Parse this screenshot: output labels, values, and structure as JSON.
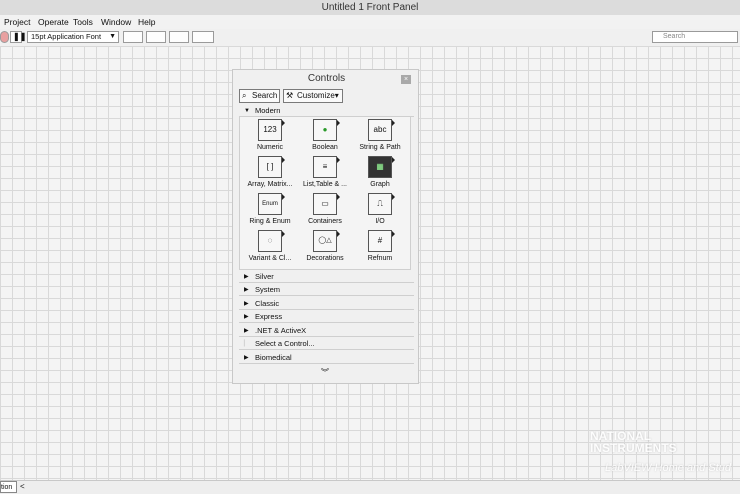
{
  "window": {
    "title": "Untitled 1 Front Panel"
  },
  "menu": [
    "Project",
    "Operate",
    "Tools",
    "Window",
    "Help"
  ],
  "toolbar": {
    "font": "15pt Application Font",
    "search_placeholder": "Search"
  },
  "palette": {
    "title": "Controls",
    "search_label": "Search",
    "customize_label": "Customize",
    "modern_label": "Modern",
    "tiles": [
      {
        "label": "Numeric",
        "icon": "numeric-icon",
        "glyph": "123"
      },
      {
        "label": "Boolean",
        "icon": "boolean-icon",
        "glyph": "●"
      },
      {
        "label": "String & Path",
        "icon": "string-path-icon",
        "glyph": "abc"
      },
      {
        "label": "Array, Matrix...",
        "icon": "array-icon",
        "glyph": "[ ]"
      },
      {
        "label": "List,Table & ...",
        "icon": "list-table-icon",
        "glyph": "≡"
      },
      {
        "label": "Graph",
        "icon": "graph-icon",
        "glyph": "▦"
      },
      {
        "label": "Ring & Enum",
        "icon": "ring-enum-icon",
        "glyph": "Enum"
      },
      {
        "label": "Containers",
        "icon": "containers-icon",
        "glyph": "▭"
      },
      {
        "label": "I/O",
        "icon": "io-icon",
        "glyph": "⎍"
      },
      {
        "label": "Variant & Cl...",
        "icon": "variant-class-icon",
        "glyph": "◌"
      },
      {
        "label": "Decorations",
        "icon": "decorations-icon",
        "glyph": "◯△"
      },
      {
        "label": "Refnum",
        "icon": "refnum-icon",
        "glyph": "#"
      }
    ],
    "categories": [
      "Silver",
      "System",
      "Classic",
      "Express",
      ".NET & ActiveX"
    ],
    "select_control": "Select a Control...",
    "biomedical": "Biomedical"
  },
  "watermark": {
    "line1": "NATIONAL",
    "line2": "INSTRUMENTS",
    "line3": "LabVIEW Home and Stud"
  },
  "status": {
    "left": "tion"
  }
}
